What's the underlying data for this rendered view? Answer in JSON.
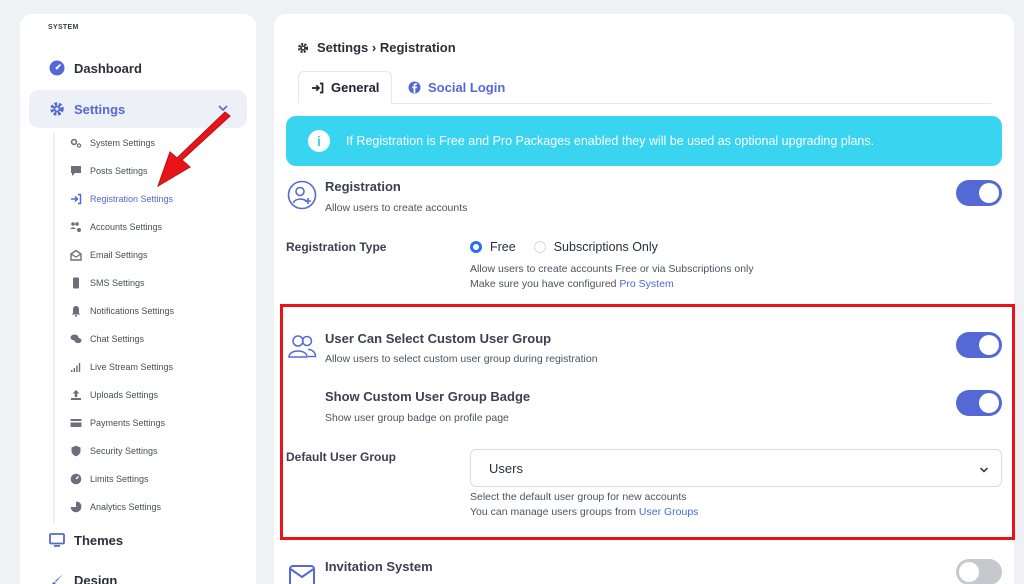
{
  "sidebar": {
    "section_label": "SYSTEM",
    "dashboard": "Dashboard",
    "settings": "Settings",
    "themes": "Themes",
    "design": "Design",
    "subitems": [
      {
        "label": "System Settings",
        "icon": "gears-icon"
      },
      {
        "label": "Posts Settings",
        "icon": "comment-icon"
      },
      {
        "label": "Registration Settings",
        "icon": "sign-in-icon"
      },
      {
        "label": "Accounts Settings",
        "icon": "users-cog-icon"
      },
      {
        "label": "Email Settings",
        "icon": "envelope-open-icon"
      },
      {
        "label": "SMS Settings",
        "icon": "mobile-icon"
      },
      {
        "label": "Notifications Settings",
        "icon": "bell-icon"
      },
      {
        "label": "Chat Settings",
        "icon": "comments-icon"
      },
      {
        "label": "Live Stream Settings",
        "icon": "signal-icon"
      },
      {
        "label": "Uploads Settings",
        "icon": "upload-icon"
      },
      {
        "label": "Payments Settings",
        "icon": "credit-card-icon"
      },
      {
        "label": "Security Settings",
        "icon": "shield-icon"
      },
      {
        "label": "Limits Settings",
        "icon": "gauge-icon"
      },
      {
        "label": "Analytics Settings",
        "icon": "pie-chart-icon"
      }
    ]
  },
  "header": {
    "breadcrumb": "Settings › Registration"
  },
  "tabs": {
    "general": "General",
    "social": "Social Login"
  },
  "alert": {
    "text": "If Registration is Free and Pro Packages enabled they will be used as optional upgrading plans."
  },
  "registration": {
    "title": "Registration",
    "desc": "Allow users to create accounts",
    "enabled": true
  },
  "registration_type": {
    "label": "Registration Type",
    "option_free": "Free",
    "option_subs": "Subscriptions Only",
    "selected": "Free",
    "hint1": "Allow users to create accounts Free or via Subscriptions only",
    "hint2_prefix": "Make sure you have configured ",
    "hint2_link": "Pro System"
  },
  "custom_group": {
    "title": "User Can Select Custom User Group",
    "desc": "Allow users to select custom user group during registration",
    "enabled": true
  },
  "group_badge": {
    "title": "Show Custom User Group Badge",
    "desc": "Show user group badge on profile page",
    "enabled": true
  },
  "default_group": {
    "label": "Default User Group",
    "value": "Users",
    "hint1": "Select the default user group for new accounts",
    "hint2_prefix": "You can manage users groups from ",
    "hint2_link": "User Groups"
  },
  "invitation": {
    "title": "Invitation System",
    "enabled": false
  },
  "colors": {
    "accent": "#5468d6",
    "alert_bg": "#38d4f0",
    "highlight": "#e8141a",
    "arrow": "#e8141a"
  }
}
